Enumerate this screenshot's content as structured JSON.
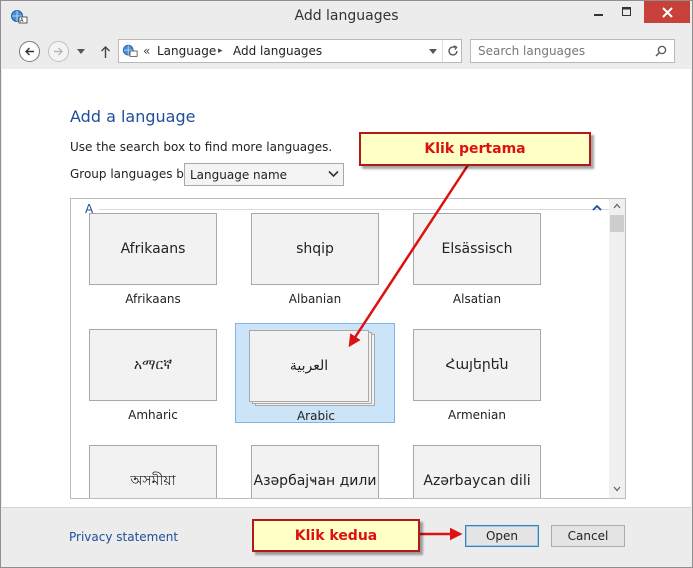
{
  "window": {
    "title": "Add languages"
  },
  "colors": {
    "accent_blue": "#1e4e9c",
    "close_red": "#c7403a",
    "selection": "#cce4f7",
    "callout_fill": "#ffffc6",
    "callout_border": "#b31919",
    "annotation_red": "#dd1111"
  },
  "address_bar": {
    "overflow": "«",
    "crumbs": [
      "Language",
      "Add languages"
    ],
    "separator": "▸"
  },
  "search": {
    "placeholder": "Search languages"
  },
  "content": {
    "heading": "Add a language",
    "instruction": "Use the search box to find more languages.",
    "group_label": "Group languages by:",
    "group_value": "Language name"
  },
  "list": {
    "group_header": "A",
    "tiles": [
      {
        "native": "Afrikaans",
        "name": "Afrikaans",
        "selected": false,
        "stacked": false
      },
      {
        "native": "shqip",
        "name": "Albanian",
        "selected": false,
        "stacked": false
      },
      {
        "native": "Elsässisch",
        "name": "Alsatian",
        "selected": false,
        "stacked": false
      },
      {
        "native": "አማርኛ",
        "name": "Amharic",
        "selected": false,
        "stacked": false
      },
      {
        "native": "العربية",
        "name": "Arabic",
        "selected": true,
        "stacked": true
      },
      {
        "native": "Հայերեն",
        "name": "Armenian",
        "selected": false,
        "stacked": false
      },
      {
        "native": "অসমীয়া",
        "name": "",
        "selected": false,
        "stacked": false
      },
      {
        "native": "Азәрбајҹан дили",
        "name": "",
        "selected": false,
        "stacked": false
      },
      {
        "native": "Azərbaycan dili",
        "name": "",
        "selected": false,
        "stacked": false
      }
    ]
  },
  "footer": {
    "privacy": "Privacy statement",
    "open_label": "Open",
    "cancel_label": "Cancel"
  },
  "annotations": {
    "first": "Klik pertama",
    "second": "Klik kedua"
  },
  "icons": {
    "app": "language-globe-icon",
    "back": "back-arrow-icon",
    "forward": "forward-arrow-icon",
    "up": "up-arrow-icon",
    "refresh": "refresh-icon",
    "search": "search-icon"
  }
}
